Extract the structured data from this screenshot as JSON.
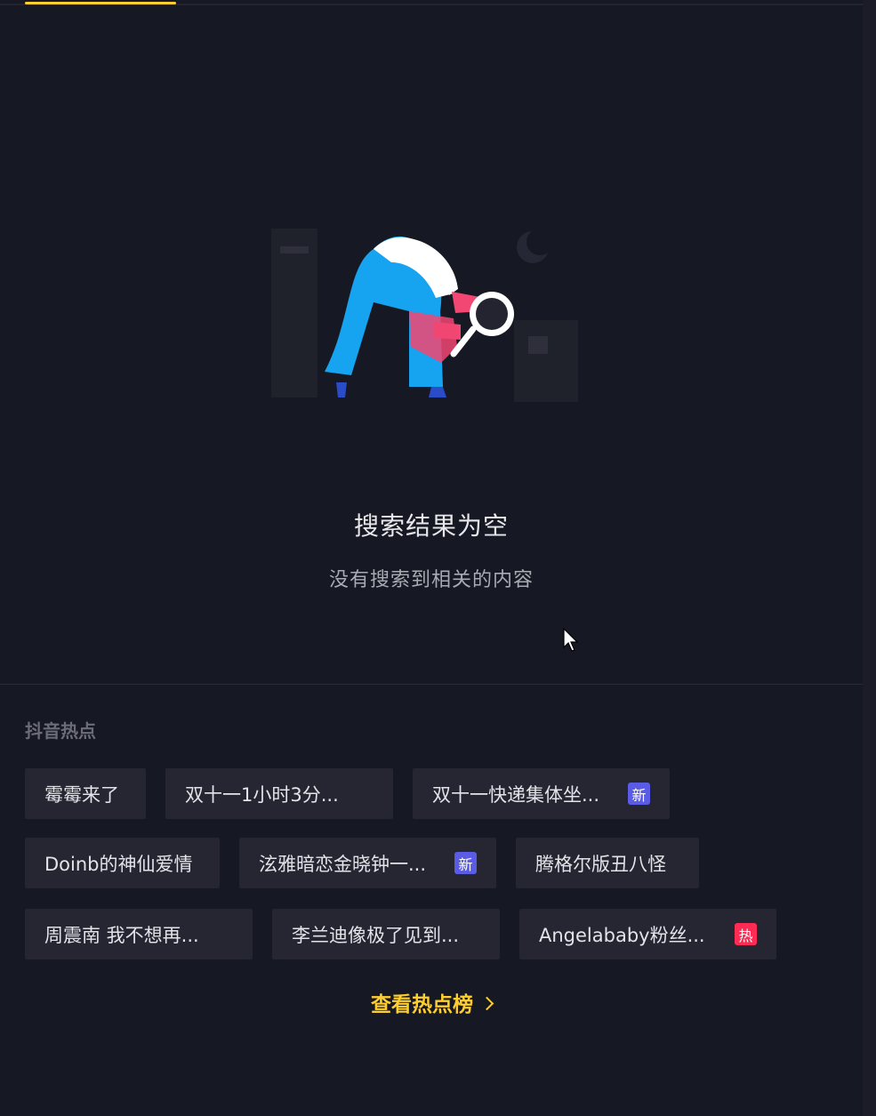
{
  "empty_state": {
    "title": "搜索结果为空",
    "description": "没有搜索到相关的内容"
  },
  "hot_section": {
    "title": "抖音热点",
    "view_more_label": "查看热点榜",
    "items": [
      {
        "label": "霉霉来了",
        "badge": ""
      },
      {
        "label": "双十一1小时3分...",
        "badge": ""
      },
      {
        "label": "双十一快递集体坐...",
        "badge": "新"
      },
      {
        "label": "Doinb的神仙爱情",
        "badge": ""
      },
      {
        "label": "泫雅暗恋金晓钟一...",
        "badge": "新"
      },
      {
        "label": "腾格尔版丑八怪",
        "badge": ""
      },
      {
        "label": "周震南 我不想再...",
        "badge": ""
      },
      {
        "label": "李兰迪像极了见到...",
        "badge": ""
      },
      {
        "label": "Angelababy粉丝...",
        "badge": "热"
      }
    ]
  },
  "colors": {
    "background": "#161823",
    "accent": "#fecd2f",
    "chip": "#252632",
    "badge_new": "#5b5ce6",
    "badge_hot": "#fe2c55"
  }
}
